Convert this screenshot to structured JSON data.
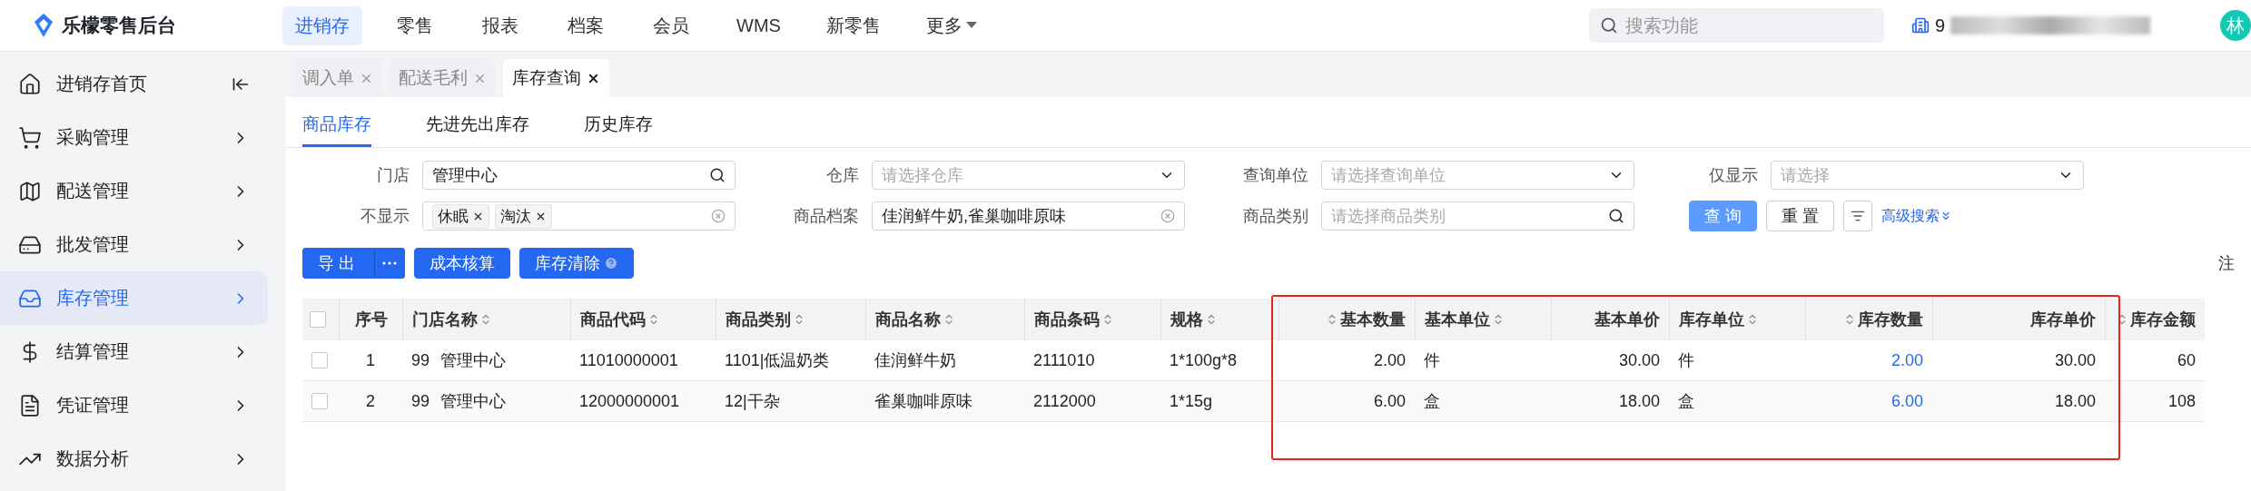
{
  "header": {
    "logo": "乐檬零售后台",
    "nav": [
      {
        "label": "进销存",
        "selected": true
      },
      {
        "label": "零售",
        "selected": false
      },
      {
        "label": "报表",
        "selected": false
      },
      {
        "label": "档案",
        "selected": false
      },
      {
        "label": "会员",
        "selected": false
      },
      {
        "label": "WMS",
        "selected": false
      },
      {
        "label": "新零售",
        "selected": false
      },
      {
        "label": "更多",
        "selected": false,
        "dropdown": true
      }
    ],
    "search": {
      "placeholder": "搜索功能"
    },
    "store_label": "9",
    "avatar": "林"
  },
  "sidebar": {
    "items": [
      {
        "label": "进销存首页",
        "selected": false,
        "kind": "home"
      },
      {
        "label": "采购管理",
        "selected": false,
        "kind": "group"
      },
      {
        "label": "配送管理",
        "selected": false,
        "kind": "group"
      },
      {
        "label": "批发管理",
        "selected": false,
        "kind": "group"
      },
      {
        "label": "库存管理",
        "selected": true,
        "kind": "group"
      },
      {
        "label": "结算管理",
        "selected": false,
        "kind": "group"
      },
      {
        "label": "凭证管理",
        "selected": false,
        "kind": "group"
      },
      {
        "label": "数据分析",
        "selected": false,
        "kind": "group"
      }
    ]
  },
  "page_tabs": [
    {
      "label": "调入单",
      "selected": false
    },
    {
      "label": "配送毛利",
      "selected": false
    },
    {
      "label": "库存查询",
      "selected": true
    }
  ],
  "sub_tabs": [
    {
      "label": "商品库存",
      "selected": true
    },
    {
      "label": "先进先出库存",
      "selected": false
    },
    {
      "label": "历史库存",
      "selected": false
    }
  ],
  "filters": [
    {
      "label": "门店",
      "kind": "search",
      "value": "管理中心"
    },
    {
      "label": "仓库",
      "kind": "select",
      "placeholder": "请选择仓库"
    },
    {
      "label": "查询单位",
      "kind": "select",
      "placeholder": "请选择查询单位"
    },
    {
      "label": "仅显示",
      "kind": "select",
      "placeholder": "请选择"
    },
    {
      "label": "不显示",
      "kind": "tags",
      "tags": [
        "休眠",
        "淘汰"
      ]
    },
    {
      "label": "商品档案",
      "kind": "clear",
      "value": "佳润鲜牛奶,雀巢咖啡原味"
    },
    {
      "label": "商品类别",
      "kind": "search",
      "placeholder": "请选择商品类别"
    }
  ],
  "filter_actions": {
    "query": "查 询",
    "reset": "重 置",
    "advanced": "高级搜索"
  },
  "toolbar": {
    "export": "导 出",
    "cost": "成本核算",
    "clear": "库存清除",
    "note": "注"
  },
  "table": {
    "columns": [
      {
        "label": "序号",
        "kind": "seq",
        "sortable": false
      },
      {
        "label": "门店名称",
        "kind": "text",
        "sortable": true
      },
      {
        "label": "商品代码",
        "kind": "text",
        "sortable": true
      },
      {
        "label": "商品类别",
        "kind": "text",
        "sortable": true
      },
      {
        "label": "商品名称",
        "kind": "text",
        "sortable": true
      },
      {
        "label": "商品条码",
        "kind": "text",
        "sortable": true
      },
      {
        "label": "规格",
        "kind": "text",
        "sortable": true
      },
      {
        "label": "基本数量",
        "kind": "number",
        "sortable": true
      },
      {
        "label": "基本单位",
        "kind": "text",
        "sortable": true
      },
      {
        "label": "基本单价",
        "kind": "number",
        "sortable": false
      },
      {
        "label": "库存单位",
        "kind": "text",
        "sortable": true
      },
      {
        "label": "库存数量",
        "kind": "link",
        "sortable": true
      },
      {
        "label": "库存单价",
        "kind": "number",
        "sortable": false
      },
      {
        "label": "库存金额",
        "kind": "number",
        "sortable": true
      }
    ],
    "rows": [
      {
        "selected": false,
        "store_code": "99",
        "cells": [
          "1",
          "管理中心",
          "11010000001",
          "1101|低温奶类",
          "佳润鲜牛奶",
          "2111010",
          "1*100g*8",
          "2.00",
          "件",
          "30.00",
          "件",
          "2.00",
          "30.00",
          "60"
        ]
      },
      {
        "selected": false,
        "store_code": "99",
        "cells": [
          "2",
          "管理中心",
          "12000000001",
          "12|干杂",
          "雀巢咖啡原味",
          "2112000",
          "1*15g",
          "6.00",
          "盒",
          "18.00",
          "盒",
          "6.00",
          "18.00",
          "108"
        ]
      }
    ],
    "all_selected": false
  }
}
